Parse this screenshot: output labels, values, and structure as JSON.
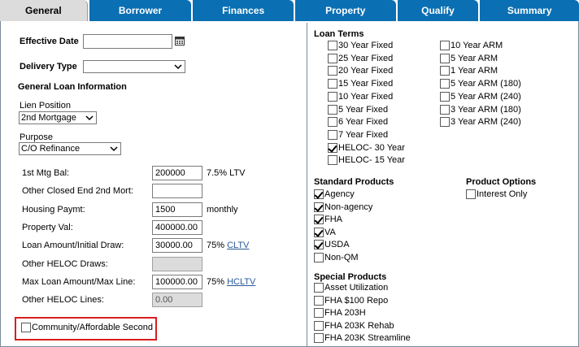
{
  "tabs": [
    "General",
    "Borrower",
    "Finances",
    "Property",
    "Qualify",
    "Summary"
  ],
  "left": {
    "effective_date_label": "Effective Date",
    "effective_date_value": "",
    "delivery_type_label": "Delivery Type",
    "delivery_type_value": "",
    "general_loan_info_heading": "General Loan Information",
    "lien_position_label": "Lien Position",
    "lien_position_value": "2nd Mortgage",
    "purpose_label": "Purpose",
    "purpose_value": "C/O Refinance",
    "fields": [
      {
        "label": "1st Mtg Bal:",
        "value": "200000",
        "suffix": "7.5% LTV",
        "link": "",
        "disabled": false
      },
      {
        "label": "Other Closed End 2nd Mort:",
        "value": "",
        "suffix": "",
        "link": "",
        "disabled": false
      },
      {
        "label": "Housing Paymt:",
        "value": "1500",
        "suffix": "monthly",
        "link": "",
        "disabled": false
      },
      {
        "label": "Property Val:",
        "value": "400000.00",
        "suffix": "",
        "link": "",
        "disabled": false
      },
      {
        "label": "Loan Amount/Initial Draw:",
        "value": "30000.00",
        "suffix": "75% ",
        "link": "CLTV",
        "disabled": false
      },
      {
        "label": "Other HELOC Draws:",
        "value": "",
        "suffix": "",
        "link": "",
        "disabled": true
      },
      {
        "label": "Max Loan Amount/Max Line:",
        "value": "100000.00",
        "suffix": "75% ",
        "link": "HCLTV",
        "disabled": false
      },
      {
        "label": "Other HELOC Lines:",
        "value": "0.00",
        "suffix": "",
        "link": "",
        "disabled": true
      }
    ],
    "community_label": "Community/Affordable Second",
    "community_checked": false
  },
  "right": {
    "loan_terms_heading": "Loan Terms",
    "loan_terms_col1": [
      {
        "label": "30 Year Fixed",
        "checked": false
      },
      {
        "label": "25 Year Fixed",
        "checked": false
      },
      {
        "label": "20 Year Fixed",
        "checked": false
      },
      {
        "label": "15 Year Fixed",
        "checked": false
      },
      {
        "label": "10 Year Fixed",
        "checked": false
      },
      {
        "label": "5 Year Fixed",
        "checked": false
      },
      {
        "label": "6 Year Fixed",
        "checked": false
      },
      {
        "label": "7 Year Fixed",
        "checked": false
      },
      {
        "label": "HELOC- 30 Year",
        "checked": true
      },
      {
        "label": "HELOC- 15 Year",
        "checked": false
      }
    ],
    "loan_terms_col2": [
      {
        "label": "10 Year ARM",
        "checked": false
      },
      {
        "label": "5 Year ARM",
        "checked": false
      },
      {
        "label": "1 Year ARM",
        "checked": false
      },
      {
        "label": "5 Year ARM (180)",
        "checked": false
      },
      {
        "label": "5 Year ARM (240)",
        "checked": false
      },
      {
        "label": "3 Year ARM (180)",
        "checked": false
      },
      {
        "label": "3 Year ARM (240)",
        "checked": false
      }
    ],
    "standard_products_heading": "Standard Products",
    "standard_products": [
      {
        "label": "Agency",
        "checked": true
      },
      {
        "label": "Non-agency",
        "checked": true
      },
      {
        "label": "FHA",
        "checked": true
      },
      {
        "label": "VA",
        "checked": true
      },
      {
        "label": "USDA",
        "checked": true
      },
      {
        "label": "Non-QM",
        "checked": false
      }
    ],
    "product_options_heading": "Product Options",
    "product_options": [
      {
        "label": "Interest Only",
        "checked": false
      }
    ],
    "special_products_heading": "Special Products",
    "special_products": [
      {
        "label": "Asset Utilization",
        "checked": false
      },
      {
        "label": "FHA $100 Repo",
        "checked": false
      },
      {
        "label": "FHA 203H",
        "checked": false
      },
      {
        "label": "FHA 203K Rehab",
        "checked": false
      },
      {
        "label": "FHA 203K Streamline",
        "checked": false
      }
    ]
  },
  "colors": {
    "tab_blue": "#0a6fb3",
    "tab_active": "#dcdcdc",
    "highlight_red": "#d81e1e",
    "link": "#2a5a9a"
  }
}
